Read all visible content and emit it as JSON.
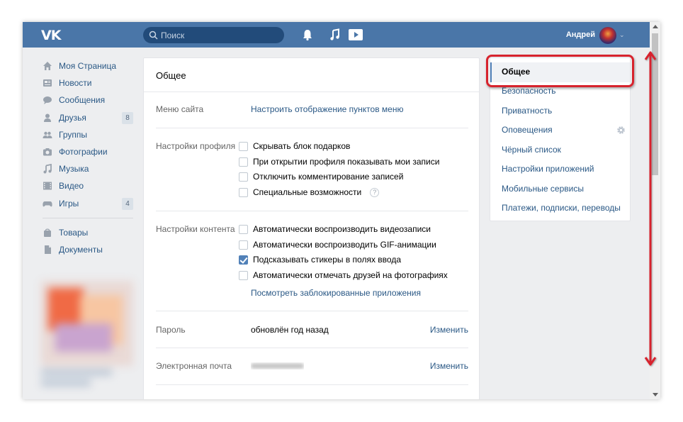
{
  "header": {
    "logo": "VK",
    "search_placeholder": "Поиск",
    "user_name": "Андрей"
  },
  "sidebar": {
    "items": [
      {
        "label": "Моя Страница",
        "icon": "home-icon",
        "count": ""
      },
      {
        "label": "Новости",
        "icon": "news-icon",
        "count": ""
      },
      {
        "label": "Сообщения",
        "icon": "messages-icon",
        "count": ""
      },
      {
        "label": "Друзья",
        "icon": "friends-icon",
        "count": "8"
      },
      {
        "label": "Группы",
        "icon": "groups-icon",
        "count": ""
      },
      {
        "label": "Фотографии",
        "icon": "camera-icon",
        "count": ""
      },
      {
        "label": "Музыка",
        "icon": "music-icon",
        "count": ""
      },
      {
        "label": "Видео",
        "icon": "video-icon",
        "count": ""
      },
      {
        "label": "Игры",
        "icon": "games-icon",
        "count": "4"
      }
    ],
    "extra": [
      {
        "label": "Товары",
        "icon": "bag-icon"
      },
      {
        "label": "Документы",
        "icon": "document-icon"
      }
    ]
  },
  "main": {
    "title": "Общее",
    "menu": {
      "label": "Меню сайта",
      "link": "Настроить отображение пунктов меню"
    },
    "profile": {
      "label": "Настройки профиля",
      "options": [
        {
          "text": "Скрывать блок подарков",
          "checked": false
        },
        {
          "text": "При открытии профиля показывать мои записи",
          "checked": false
        },
        {
          "text": "Отключить комментирование записей",
          "checked": false
        },
        {
          "text": "Специальные возможности",
          "checked": false
        }
      ],
      "help": "?"
    },
    "content": {
      "label": "Настройки контента",
      "options": [
        {
          "text": "Автоматически воспроизводить видеозаписи",
          "checked": false
        },
        {
          "text": "Автоматически воспроизводить GIF-анимации",
          "checked": false
        },
        {
          "text": "Подсказывать стикеры в полях ввода",
          "checked": true
        },
        {
          "text": "Автоматически отмечать друзей на фотографиях",
          "checked": false
        }
      ],
      "link": "Посмотреть заблокированные приложения"
    },
    "password": {
      "label": "Пароль",
      "value": "обновлён год назад",
      "action": "Изменить"
    },
    "email": {
      "label": "Электронная почта",
      "action": "Изменить"
    }
  },
  "rightmenu": {
    "items": [
      "Общее",
      "Безопасность",
      "Приватность",
      "Оповещения",
      "Чёрный список",
      "Настройки приложений",
      "Мобильные сервисы",
      "Платежи, подписки, переводы"
    ],
    "active": "Общее"
  },
  "colors": {
    "header": "#4a76a8",
    "link": "#2a5885",
    "highlight": "#d7232d",
    "accent": "#5181b8"
  }
}
